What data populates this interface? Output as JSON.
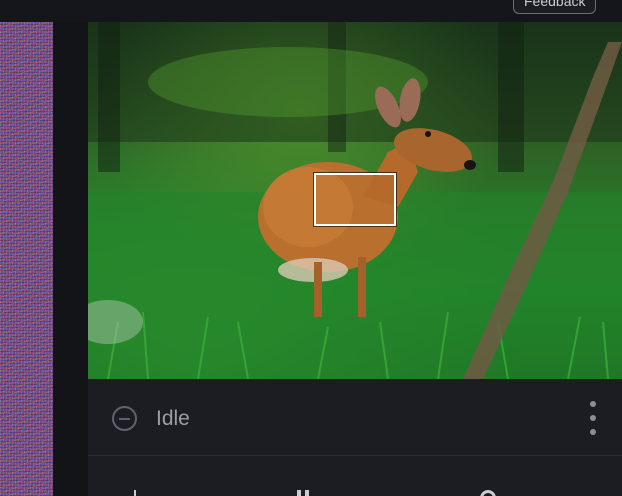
{
  "topbar": {
    "feedback_label": "Feedback"
  },
  "card": {
    "status": {
      "label": "Idle",
      "icon": "minus-circle-icon"
    },
    "menu_icon": "more-vertical-icon",
    "controls": [
      {
        "icon": "add-icon"
      },
      {
        "icon": "pause-icon"
      },
      {
        "icon": "refresh-icon"
      }
    ]
  },
  "colors": {
    "background": "#16181d",
    "card": "#1b1d23",
    "status_text": "#9a9ea6",
    "focus_box": "#ffffff"
  }
}
